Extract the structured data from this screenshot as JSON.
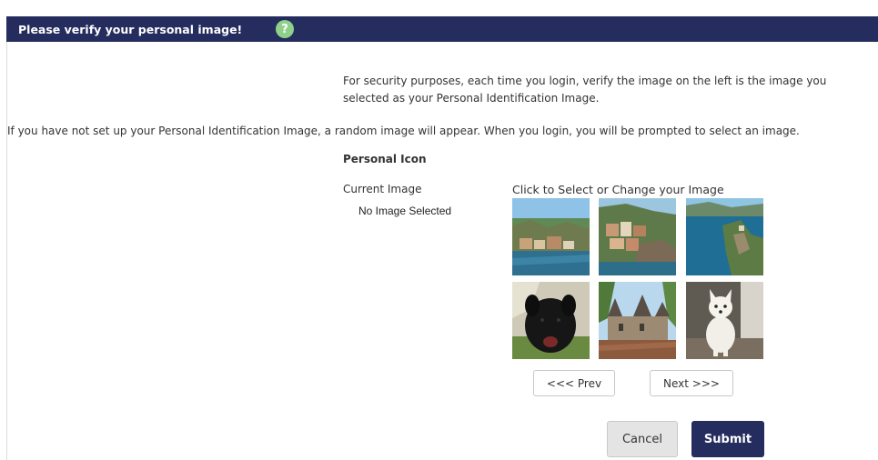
{
  "header": {
    "title": "Please verify your personal image!",
    "help_icon": "?"
  },
  "intro_text": "For security purposes, each time you login, verify the image on the left is the image you selected as your Personal Identification Image.",
  "notice_text": "If you have not set up your Personal Identification Image, a random image will appear. When you login, you will be prompted to select an image.",
  "personal_icon": {
    "section_title": "Personal Icon",
    "current_label": "Current Image",
    "current_value": "No Image Selected",
    "select_label": "Click to Select or Change your Image"
  },
  "images": [
    {
      "icon": "coastal-village-image"
    },
    {
      "icon": "cliff-houses-image"
    },
    {
      "icon": "sea-cliff-image"
    },
    {
      "icon": "black-dog-image"
    },
    {
      "icon": "chateau-image"
    },
    {
      "icon": "white-puppy-image"
    }
  ],
  "pager": {
    "prev_label": "<<< Prev",
    "next_label": "Next >>>"
  },
  "actions": {
    "cancel_label": "Cancel",
    "submit_label": "Submit"
  },
  "colors": {
    "header_bg": "#252c5e",
    "help_icon": "#8fd08a",
    "submit_bg": "#252c5e"
  }
}
